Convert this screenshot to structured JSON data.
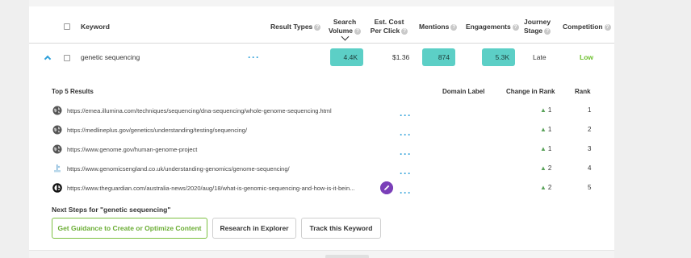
{
  "header": {
    "keyword": "Keyword",
    "result_types": "Result Types",
    "search_volume_1": "Search",
    "search_volume_2": "Volume",
    "est_cost_1": "Est. Cost",
    "est_cost_2": "Per Click",
    "mentions": "Mentions",
    "engagements": "Engagements",
    "journey_1": "Journey",
    "journey_2": "Stage",
    "competition": "Competition",
    "help_icon": "?"
  },
  "row": {
    "keyword": "genetic sequencing",
    "search_volume": "4.4K",
    "cpc": "$1.36",
    "mentions": "874",
    "engagements": "5.3K",
    "journey_stage": "Late",
    "competition": "Low",
    "competition_color": "#6bbf2a",
    "pill_color": "#5ccfc6"
  },
  "results_section": {
    "title": "Top 5 Results",
    "domain_label": "Domain Label",
    "change_in_rank": "Change in Rank",
    "rank": "Rank",
    "items": [
      {
        "url": "https://emea.illumina.com/techniques/sequencing/dna-sequencing/whole-genome-sequencing.html",
        "change": "1",
        "rank": "1",
        "icon": "globe-icon"
      },
      {
        "url": "https://medlineplus.gov/genetics/understanding/testing/sequencing/",
        "change": "1",
        "rank": "2",
        "icon": "globe-icon"
      },
      {
        "url": "https://www.genome.gov/human-genome-project",
        "change": "1",
        "rank": "3",
        "icon": "globe-icon"
      },
      {
        "url": "https://www.genomicsengland.co.uk/understanding-genomics/genome-sequencing/",
        "change": "2",
        "rank": "4",
        "icon": "genomics-england-icon"
      },
      {
        "url": "https://www.theguardian.com/australia-news/2020/aug/18/what-is-genomic-sequencing-and-how-is-it-bein...",
        "change": "2",
        "rank": "5",
        "icon": "guardian-icon"
      }
    ]
  },
  "next_steps": {
    "title": "Next Steps for \"genetic sequencing\"",
    "guidance_button": "Get Guidance to Create or Optimize Content",
    "explorer_button": "Research in Explorer",
    "track_button": "Track this Keyword"
  },
  "icons": {
    "rank_up": "▲"
  }
}
